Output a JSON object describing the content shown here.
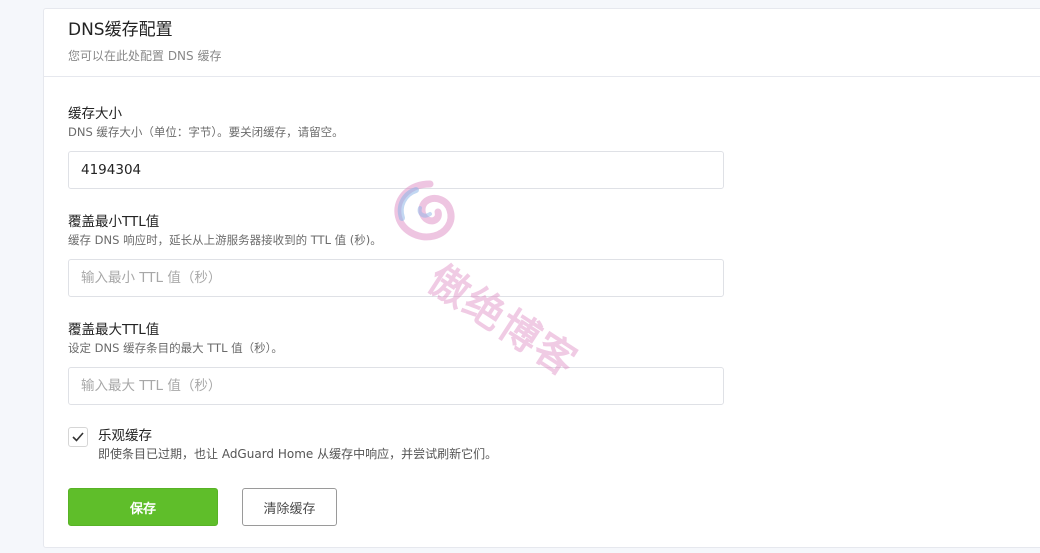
{
  "header": {
    "title": "DNS缓存配置",
    "subtitle": "您可以在此处配置 DNS 缓存"
  },
  "fields": [
    {
      "label": "缓存大小",
      "description": "DNS 缓存大小（单位：字节）。要关闭缓存，请留空。",
      "value": "4194304",
      "placeholder": ""
    },
    {
      "label": "覆盖最小TTL值",
      "description": "缓存 DNS 响应时，延长从上游服务器接收到的 TTL 值 (秒)。",
      "value": "",
      "placeholder": "输入最小 TTL 值（秒）"
    },
    {
      "label": "覆盖最大TTL值",
      "description": "设定 DNS 缓存条目的最大 TTL 值（秒）。",
      "value": "",
      "placeholder": "输入最大 TTL 值（秒）"
    }
  ],
  "optimistic": {
    "label": "乐观缓存",
    "description": "即使条目已过期，也让 AdGuard Home 从缓存中响应，并尝试刷新它们。",
    "checked": true
  },
  "buttons": {
    "save": "保存",
    "clear": "清除缓存"
  },
  "watermark": {
    "text": "傲绝博客"
  },
  "colors": {
    "accent_green": "#5fbe2a",
    "watermark_pink": "#de8cc4",
    "watermark_blue": "#8fb6e8"
  }
}
